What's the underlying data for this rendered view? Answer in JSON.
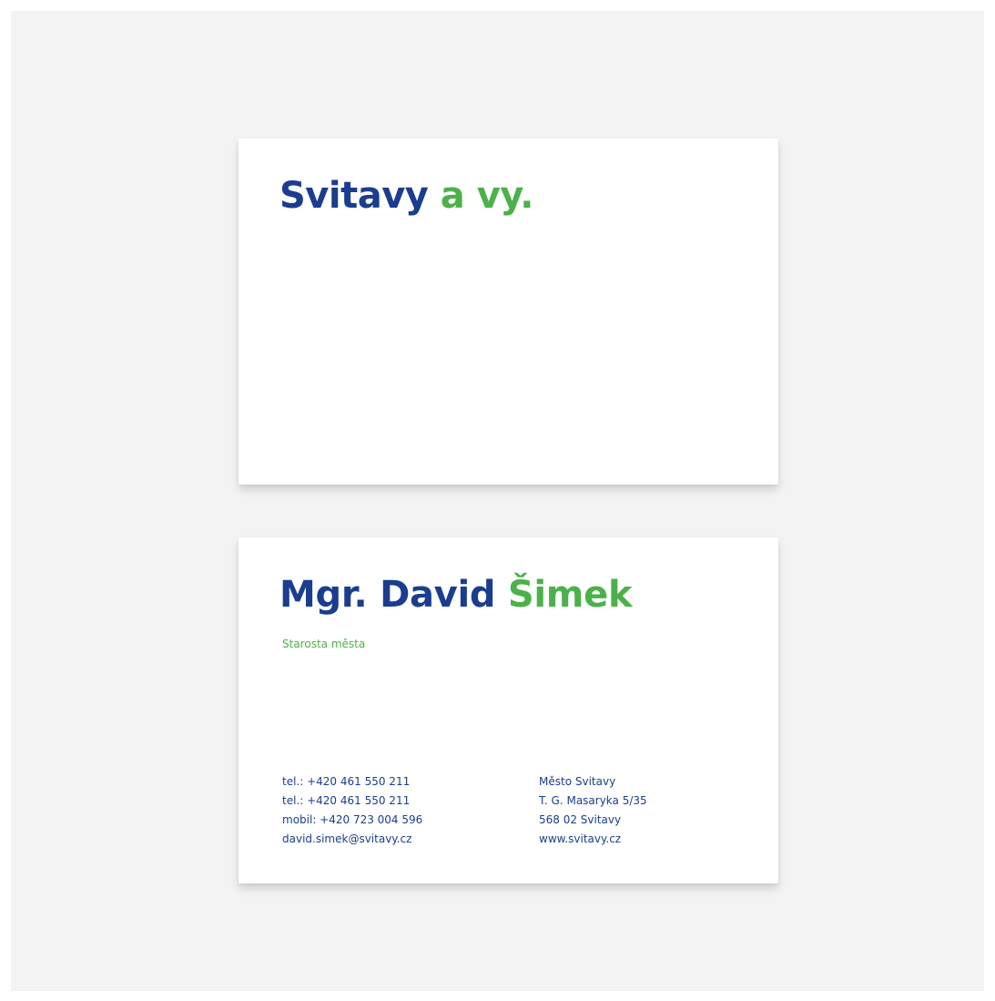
{
  "front_card": {
    "logo_primary": "Svitavy",
    "logo_secondary": "a vy."
  },
  "back_card": {
    "name_primary": "Mgr. David",
    "name_secondary": "Šimek",
    "role": "Starosta města",
    "contact_left": [
      "tel.: +420 461 550 211",
      "tel.: +420 461 550 211",
      "mobil: +420 723 004 596",
      "david.simek@svitavy.cz"
    ],
    "contact_right": [
      "Město Svitavy",
      "T. G. Masaryka 5/35",
      "568 02 Svitavy",
      "www.svitavy.cz"
    ]
  },
  "colors": {
    "brand_blue": "#1b3d8f",
    "brand_green": "#4cb14a",
    "backdrop": "#f3f3f3"
  }
}
